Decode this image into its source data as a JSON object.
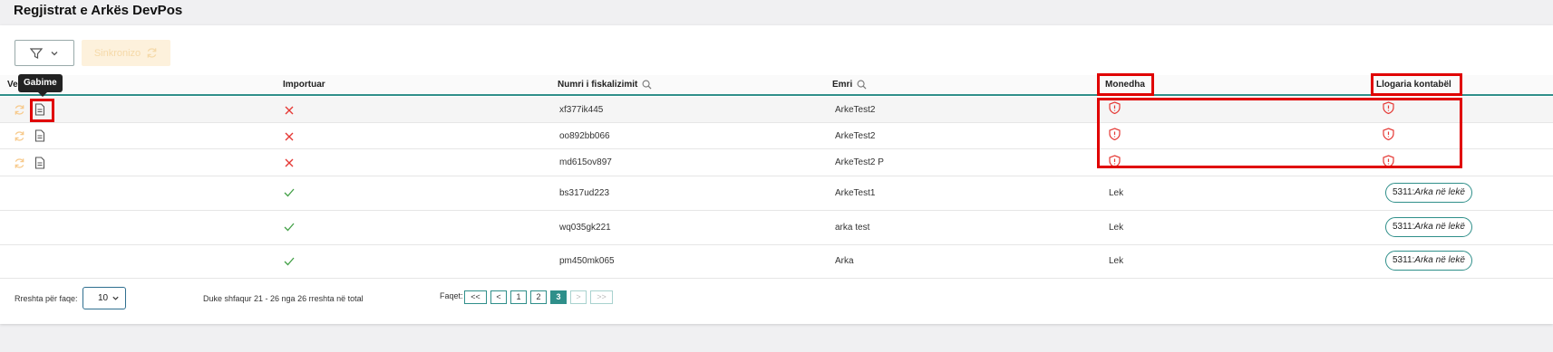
{
  "page": {
    "title": "Regjistrat e Arkës DevPos"
  },
  "toolbar": {
    "sync_label": "Sinkronizo"
  },
  "table": {
    "headers": {
      "first": "Ve",
      "imported": "Importuar",
      "fiscal_number": "Numri i fiskalizimit",
      "name": "Emri",
      "currency": "Monedha",
      "account": "Llogaria kontabël"
    },
    "tooltip": "Gabime",
    "rows": [
      {
        "fiscal": "xf377ik445",
        "name": "ArkeTest2",
        "imported": false,
        "currency": "",
        "account_code": "",
        "account_name": ""
      },
      {
        "fiscal": "oo892bb066",
        "name": "ArkeTest2",
        "imported": false,
        "currency": "",
        "account_code": "",
        "account_name": ""
      },
      {
        "fiscal": "md615ov897",
        "name": "ArkeTest2 P",
        "imported": false,
        "currency": "",
        "account_code": "",
        "account_name": ""
      },
      {
        "fiscal": "bs317ud223",
        "name": "ArkeTest1",
        "imported": true,
        "currency": "Lek",
        "account_code": "5311:",
        "account_name": "Arka në lekë"
      },
      {
        "fiscal": "wq035gk221",
        "name": "arka test",
        "imported": true,
        "currency": "Lek",
        "account_code": "5311:",
        "account_name": "Arka në lekë"
      },
      {
        "fiscal": "pm450mk065",
        "name": "Arka",
        "imported": true,
        "currency": "Lek",
        "account_code": "5311:",
        "account_name": "Arka në lekë"
      }
    ]
  },
  "footer": {
    "rows_per_page_label": "Rreshta për faqe:",
    "rows_per_page_value": "10",
    "showing_text": "Duke shfaqur 21 - 26 nga 26 rreshta në total",
    "pages_label": "Faqet:",
    "pages": [
      "<<",
      "<",
      "1",
      "2",
      "3",
      ">",
      ">>"
    ],
    "current_page": "3"
  },
  "colors": {
    "accent": "#2f8f8a",
    "error": "#e53935",
    "success": "#43a047",
    "highlight": "#e00000"
  },
  "icons": {
    "filter": "filter-icon",
    "chevron": "chevron-down-icon",
    "sync": "sync-icon",
    "errors": "document-icon",
    "search": "search-icon",
    "not_imported": "cross-icon",
    "imported": "check-icon",
    "missing": "shield-alert-icon"
  }
}
